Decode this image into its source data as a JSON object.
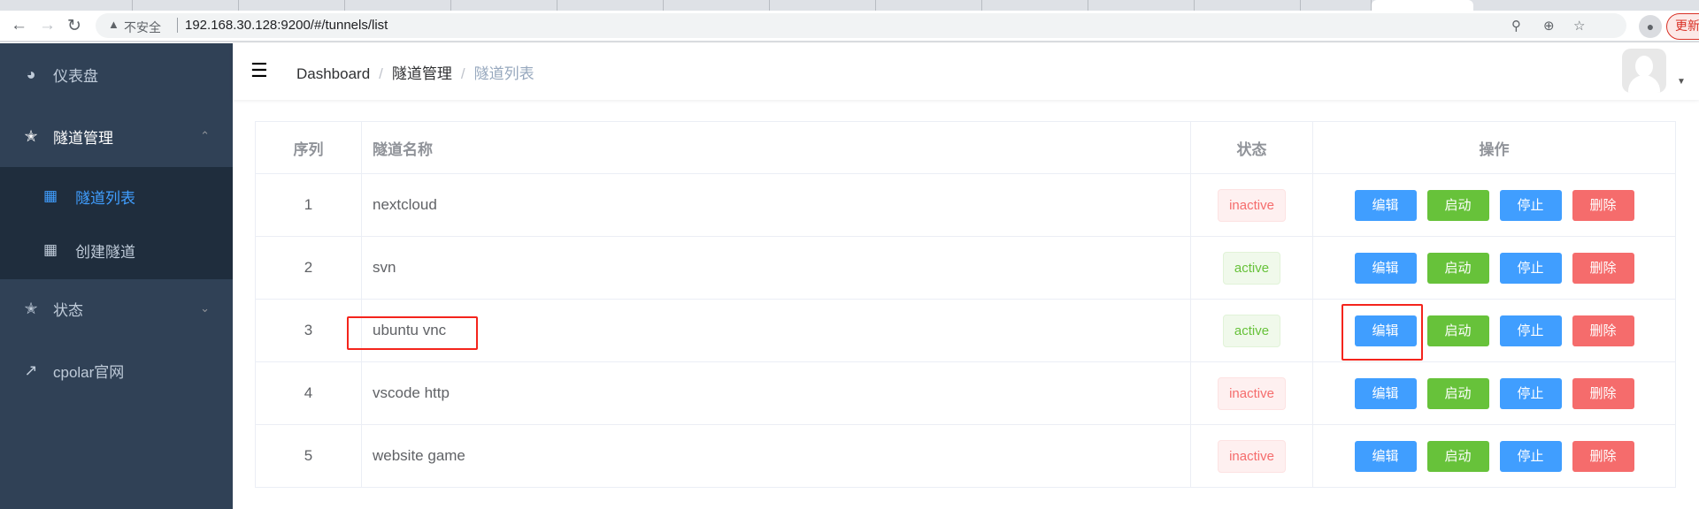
{
  "browser": {
    "insecure_label": "不安全",
    "url": "192.168.30.128:9200/#/tunnels/list",
    "update_label": "更新"
  },
  "sidebar": {
    "items": [
      {
        "label": "仪表盘",
        "icon": "dashboard-icon"
      },
      {
        "label": "隧道管理",
        "icon": "tunnel-icon",
        "expanded": true,
        "children": [
          {
            "label": "隧道列表",
            "icon": "grid-icon",
            "active": true
          },
          {
            "label": "创建隧道",
            "icon": "grid-icon"
          }
        ]
      },
      {
        "label": "状态",
        "icon": "status-icon",
        "expanded": false
      },
      {
        "label": "cpolar官网",
        "icon": "external-link-icon"
      }
    ]
  },
  "header": {
    "breadcrumb": [
      "Dashboard",
      "隧道管理",
      "隧道列表"
    ]
  },
  "table": {
    "headers": [
      "序列",
      "隧道名称",
      "状态",
      "操作"
    ],
    "actions": {
      "edit": "编辑",
      "start": "启动",
      "stop": "停止",
      "delete": "删除"
    },
    "rows": [
      {
        "index": "1",
        "name": "nextcloud",
        "status": "inactive"
      },
      {
        "index": "2",
        "name": "svn",
        "status": "active"
      },
      {
        "index": "3",
        "name": "ubuntu vnc",
        "status": "active"
      },
      {
        "index": "4",
        "name": "vscode http",
        "status": "inactive"
      },
      {
        "index": "5",
        "name": "website game",
        "status": "inactive"
      }
    ]
  },
  "colors": {
    "sidebar": "#304156",
    "submenu": "#1f2d3d",
    "active": "#409eff",
    "success": "#67c23a",
    "danger": "#f56c6c",
    "highlight": "#f4241c"
  }
}
